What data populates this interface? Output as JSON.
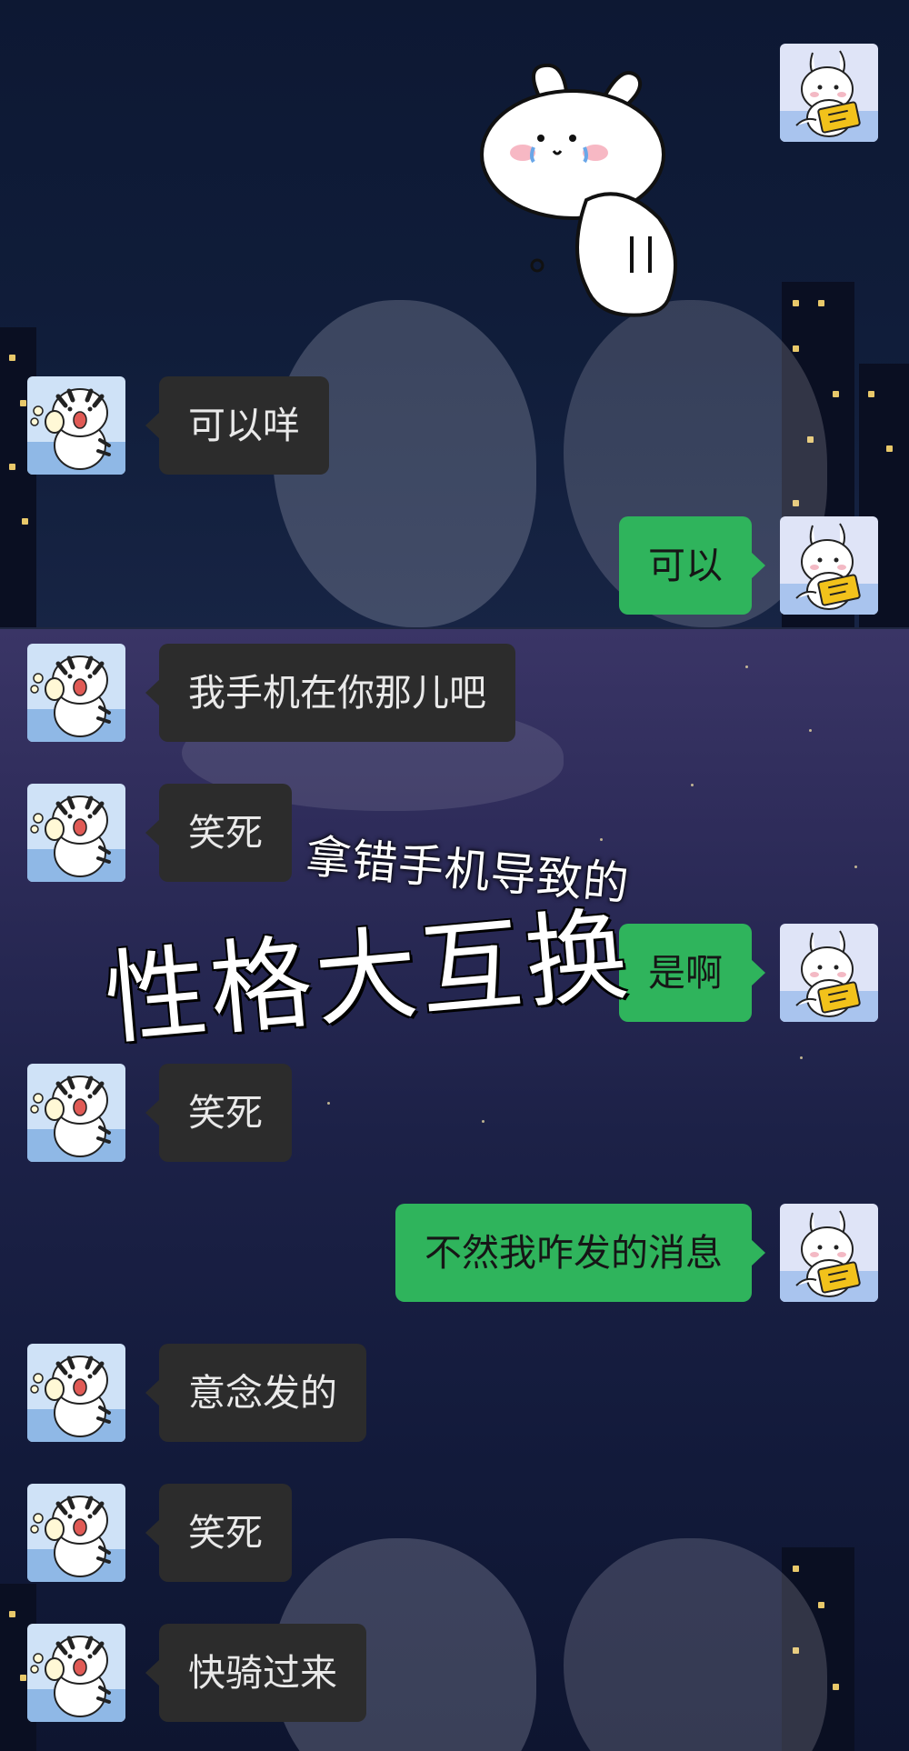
{
  "conversation": {
    "messages": [
      {
        "sender": "other",
        "text": "可以咩"
      },
      {
        "sender": "me",
        "text": "可以"
      },
      {
        "sender": "other",
        "text": "我手机在你那儿吧"
      },
      {
        "sender": "other",
        "text": "笑死"
      },
      {
        "sender": "me",
        "text": "是啊"
      },
      {
        "sender": "other",
        "text": "笑死"
      },
      {
        "sender": "me",
        "text": "不然我咋发的消息"
      },
      {
        "sender": "other",
        "text": "意念发的"
      },
      {
        "sender": "other",
        "text": "笑死"
      },
      {
        "sender": "other",
        "text": "快骑过来"
      }
    ]
  },
  "overlay": {
    "caption_line1": "拿错手机导致的",
    "caption_line2": "性格大互换"
  },
  "colors": {
    "incoming_bubble": "#2c2c2c",
    "outgoing_bubble": "#2fb45c",
    "incoming_text": "#e9e9e9",
    "outgoing_text": "#161616"
  },
  "icons": {
    "other_avatar": "tiger-cat-avatar-icon",
    "my_avatar": "white-bunny-avatar-icon",
    "sticker": "crying-bunny-sticker-icon"
  }
}
